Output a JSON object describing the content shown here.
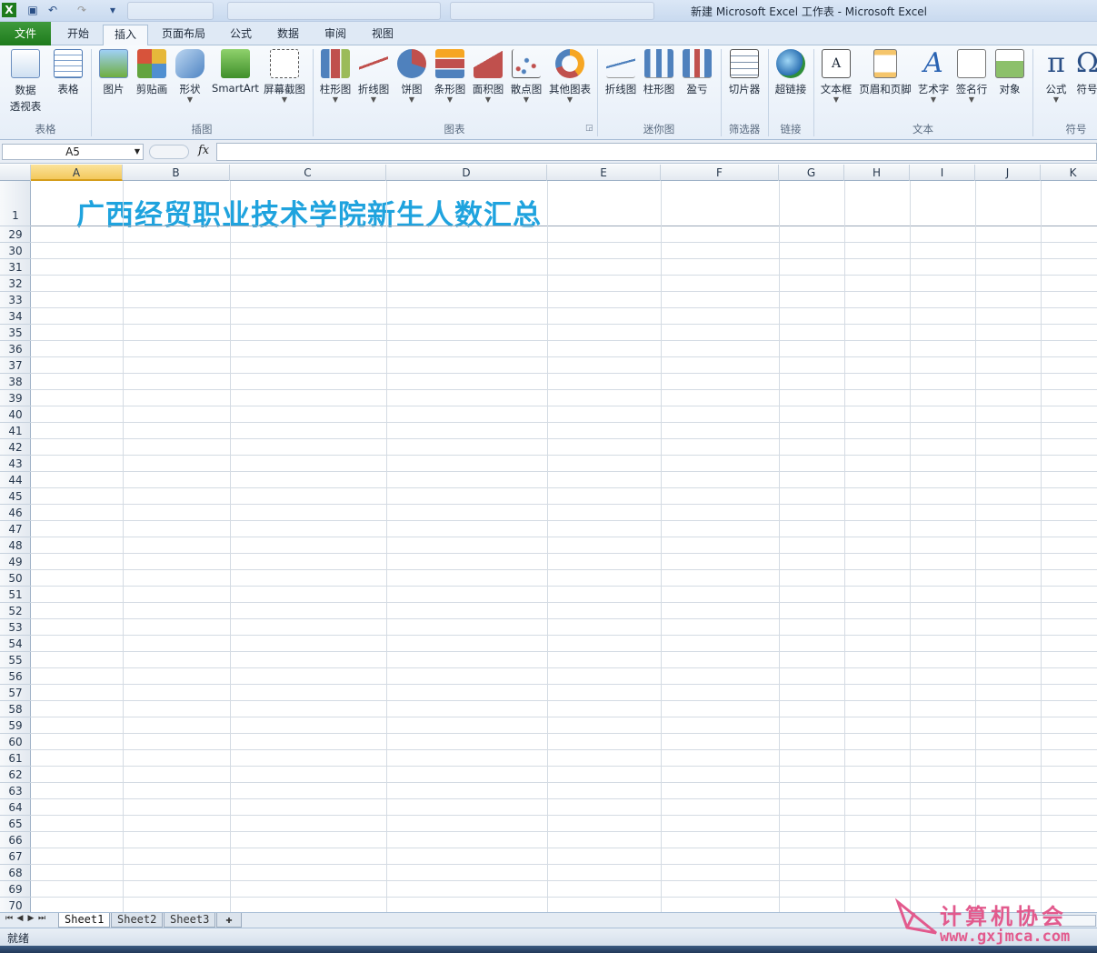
{
  "window": {
    "title": "新建 Microsoft Excel 工作表 - Microsoft Excel"
  },
  "tabs": [
    "文件",
    "开始",
    "插入",
    "页面布局",
    "公式",
    "数据",
    "审阅",
    "视图"
  ],
  "ribbon": {
    "buttons": [
      "数据\n透视表",
      "表格",
      "图片",
      "剪贴画",
      "形状",
      "SmartArt",
      "屏幕截图",
      "柱形图",
      "折线图",
      "饼图",
      "条形图",
      "面积图",
      "散点图",
      "其他图表",
      "折线图",
      "柱形图",
      "盈亏",
      "切片器",
      "超链接",
      "文本框",
      "页眉和页脚",
      "艺术字",
      "签名行",
      "对象",
      "公式",
      "符号"
    ],
    "groups": [
      "表格",
      "插图",
      "图表",
      "迷你图",
      "筛选器",
      "链接",
      "文本",
      "符号"
    ]
  },
  "formula_bar": {
    "name_box": "A5",
    "fx": "fx",
    "value": ""
  },
  "columns": [
    "A",
    "B",
    "C",
    "D",
    "E",
    "F",
    "G",
    "H",
    "I",
    "J",
    "K"
  ],
  "rows": [
    "1",
    "29",
    "30",
    "31",
    "32",
    "33",
    "34",
    "35",
    "36",
    "37",
    "38",
    "39",
    "40",
    "41",
    "42",
    "43",
    "44",
    "45",
    "46",
    "47",
    "48",
    "49",
    "50",
    "51",
    "52",
    "53",
    "54",
    "55",
    "56",
    "57",
    "58",
    "59",
    "60",
    "61",
    "62",
    "63",
    "64",
    "65",
    "66",
    "67",
    "68",
    "69",
    "70"
  ],
  "sheet_title": "广西经贸职业技术学院新生人数汇总",
  "sheets": [
    "Sheet1",
    "Sheet2",
    "Sheet3"
  ],
  "status": "就绪",
  "watermark": {
    "name": "计算机协会",
    "url": "www.gxjmca.com"
  }
}
